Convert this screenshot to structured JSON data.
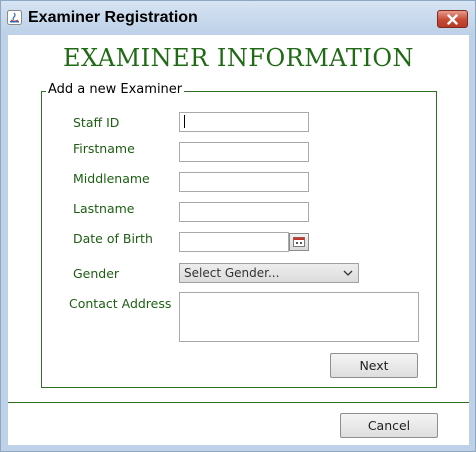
{
  "window": {
    "title": "Examiner Registration",
    "accent": "#1f6a14",
    "close_label": "×"
  },
  "form": {
    "heading": "EXAMINER INFORMATION",
    "group_title": "Add a new Examiner",
    "fields": {
      "staff_id": {
        "label": "Staff ID",
        "value": ""
      },
      "firstname": {
        "label": "Firstname",
        "value": ""
      },
      "middlename": {
        "label": "Middlename",
        "value": ""
      },
      "lastname": {
        "label": "Lastname",
        "value": ""
      },
      "date_of_birth": {
        "label": "Date of Birth",
        "value": "",
        "button_icon": "calendar-icon"
      },
      "gender": {
        "label": "Gender",
        "selected": "Select Gender...",
        "icon": "chevron-down-icon"
      },
      "contact_address": {
        "label": "Contact Address",
        "value": ""
      }
    },
    "next_label": "Next"
  },
  "footer": {
    "cancel_label": "Cancel"
  }
}
